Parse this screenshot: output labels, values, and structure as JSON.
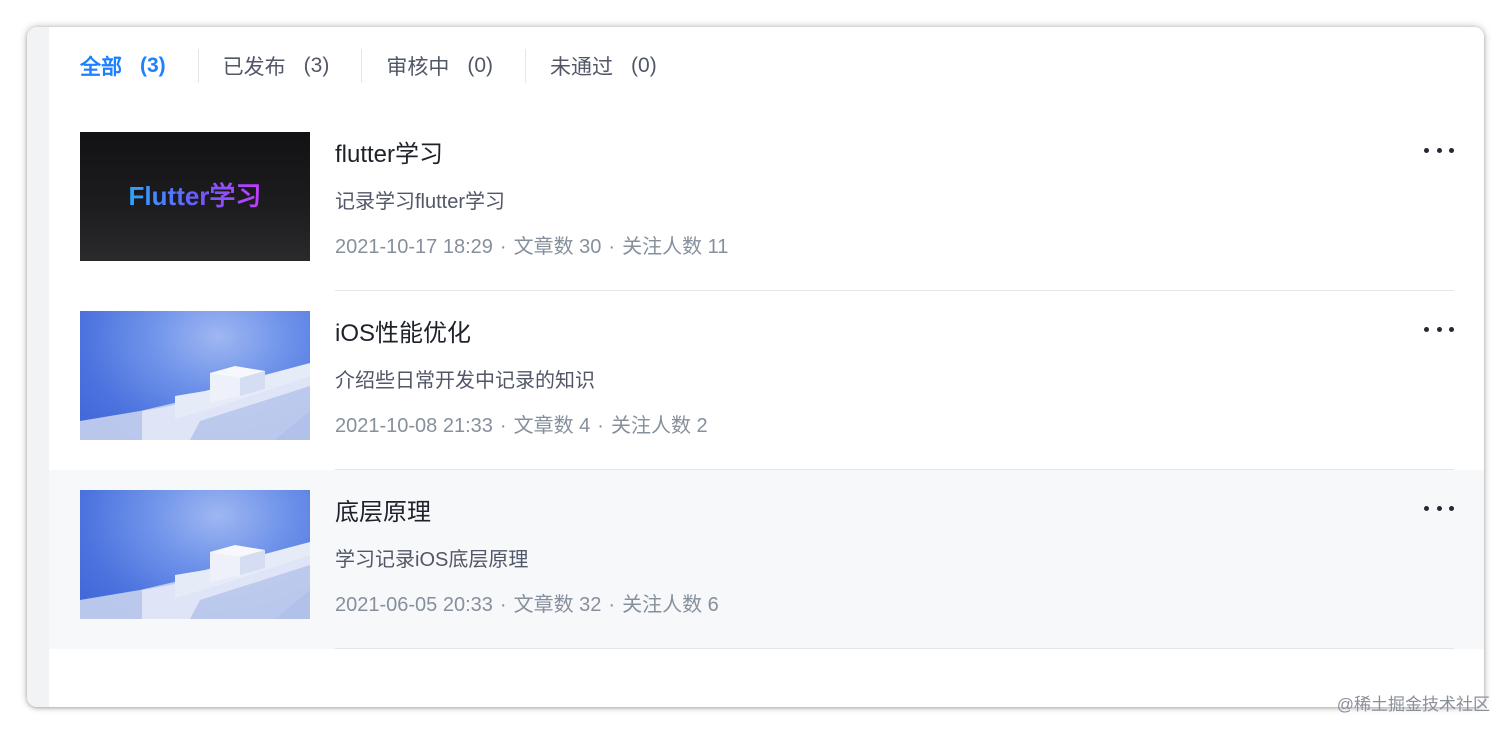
{
  "tabs": [
    {
      "label": "全部",
      "count": "(3)",
      "active": true
    },
    {
      "label": "已发布",
      "count": "(3)",
      "active": false
    },
    {
      "label": "审核中",
      "count": "(0)",
      "active": false
    },
    {
      "label": "未通过",
      "count": "(0)",
      "active": false
    }
  ],
  "columns": [
    {
      "title": "flutter学习",
      "description": "记录学习flutter学习",
      "date": "2021-10-17 18:29",
      "articles": "文章数 30",
      "followers": "关注人数 11",
      "cover_text": "Flutter学习"
    },
    {
      "title": "iOS性能优化",
      "description": "介绍些日常开发中记录的知识",
      "date": "2021-10-08 21:33",
      "articles": "文章数 4",
      "followers": "关注人数 2"
    },
    {
      "title": "底层原理",
      "description": "学习记录iOS底层原理",
      "date": "2021-06-05 20:33",
      "articles": "文章数 32",
      "followers": "关注人数 6"
    }
  ],
  "meta_separator": "·",
  "watermark": "@稀土掘金技术社区",
  "colors": {
    "accent": "#1e80ff",
    "title_text": "#1d2129",
    "secondary_text": "#515767",
    "meta_text": "#86909c",
    "divider": "#e4e6eb",
    "hover_row": "#f7f8fa"
  },
  "icons": {
    "more": "more-horizontal-icon"
  }
}
